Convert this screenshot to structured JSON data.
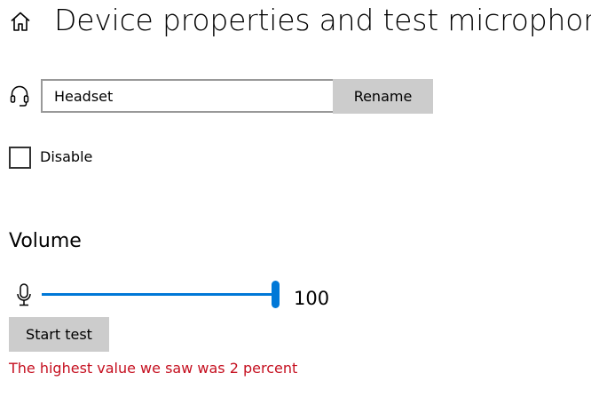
{
  "header": {
    "home_icon": "home-icon",
    "title": "Device properties and test microphone"
  },
  "device": {
    "icon": "headset-icon",
    "name_value": "Headset",
    "rename_label": "Rename"
  },
  "disable": {
    "label": "Disable",
    "checked": false
  },
  "volume": {
    "heading": "Volume",
    "icon": "microphone-icon",
    "value": "100",
    "level": 100,
    "max": 100
  },
  "test": {
    "start_label": "Start test",
    "result_text": "The highest value we saw was 2 percent"
  },
  "colors": {
    "accent": "#0078d7",
    "error": "#c50f1f",
    "button_bg": "#cccccc",
    "field_border": "#999999"
  }
}
